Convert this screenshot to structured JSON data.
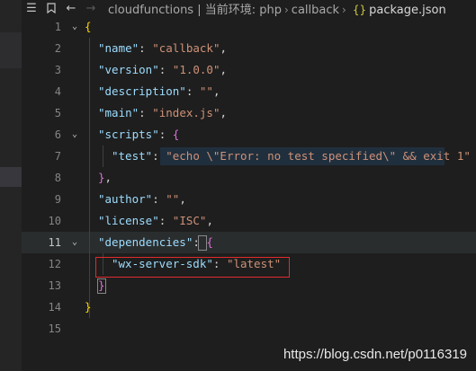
{
  "toolbar": {
    "list_icon": "list-icon",
    "bookmark_icon": "bookmark-icon",
    "back_icon": "arrow-left-icon",
    "forward_icon": "arrow-right-icon",
    "breadcrumb": [
      "cloudfunctions | 当前环境: php",
      "callback",
      "package.json"
    ]
  },
  "editor": {
    "lines": [
      {
        "n": "1",
        "fold": true
      },
      {
        "n": "2"
      },
      {
        "n": "3"
      },
      {
        "n": "4"
      },
      {
        "n": "5"
      },
      {
        "n": "6",
        "fold": true
      },
      {
        "n": "7"
      },
      {
        "n": "8"
      },
      {
        "n": "9"
      },
      {
        "n": "10"
      },
      {
        "n": "11",
        "fold": true
      },
      {
        "n": "12"
      },
      {
        "n": "13"
      },
      {
        "n": "14"
      },
      {
        "n": "15"
      }
    ],
    "code": {
      "l1": "{",
      "name_key": "\"name\"",
      "name_val": "\"callback\"",
      "version_key": "\"version\"",
      "version_val": "\"1.0.0\"",
      "desc_key": "\"description\"",
      "desc_val": "\"\"",
      "main_key": "\"main\"",
      "main_val": "\"index.js\"",
      "scripts_key": "\"scripts\"",
      "scripts_open": "{",
      "test_key": "\"test\"",
      "test_val": "\"echo \\\"Error: no test specified\\\" && exit 1\"",
      "scripts_close": "}",
      "author_key": "\"author\"",
      "author_val": "\"\"",
      "license_key": "\"license\"",
      "license_val": "\"ISC\"",
      "deps_key": "\"dependencies\"",
      "deps_open": "{",
      "sdk_key": "\"wx-server-sdk\"",
      "sdk_val": "\"latest\"",
      "deps_close": "}",
      "l14": "}"
    }
  },
  "watermark": "https://blog.csdn.net/p0116319"
}
